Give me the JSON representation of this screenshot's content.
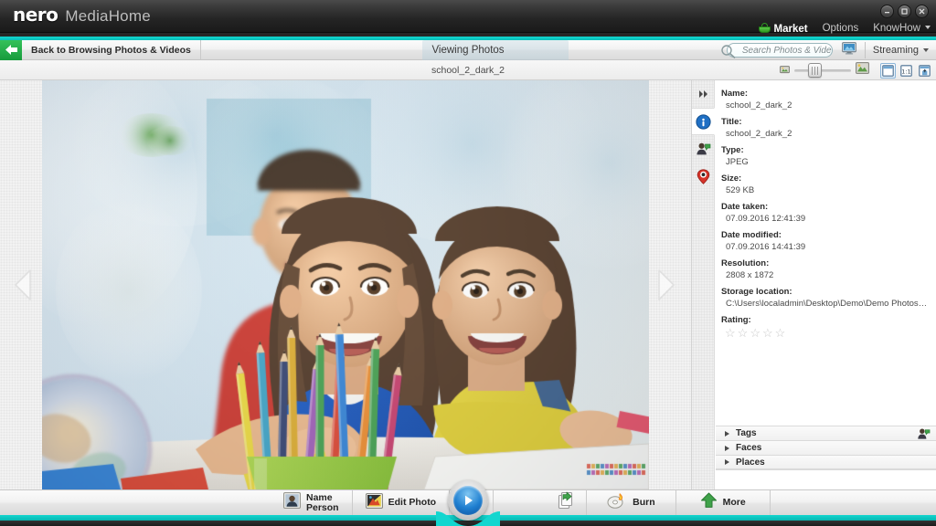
{
  "window": {
    "brand": "nero",
    "app_name": "MediaHome",
    "controls": [
      {
        "name": "minimize",
        "glyph": "–"
      },
      {
        "name": "maximize",
        "glyph": "□"
      },
      {
        "name": "close",
        "glyph": "✕"
      }
    ]
  },
  "topmenu": {
    "market": "Market",
    "options": "Options",
    "knowhow": "KnowHow"
  },
  "navbar": {
    "back_label": "Back to Browsing Photos & Videos",
    "view_label": "Viewing Photos",
    "search_placeholder": "Search Photos & Vide..",
    "streaming_label": "Streaming"
  },
  "toolbar": {
    "file_title": "school_2_dark_2",
    "zoom_value": 25,
    "view_buttons": [
      {
        "name": "fit-to-window",
        "active": true
      },
      {
        "name": "actual-size",
        "label": "1:1",
        "active": false
      },
      {
        "name": "full-screen",
        "active": false
      }
    ]
  },
  "rail": [
    {
      "name": "collapse-panel-icon",
      "active": false
    },
    {
      "name": "info-icon",
      "active": true
    },
    {
      "name": "face-tag-icon",
      "active": false
    },
    {
      "name": "location-pin-icon",
      "active": false
    }
  ],
  "metadata": [
    {
      "label": "Name:",
      "value": "school_2_dark_2"
    },
    {
      "label": "Title:",
      "value": "school_2_dark_2"
    },
    {
      "label": "Type:",
      "value": "JPEG"
    },
    {
      "label": "Size:",
      "value": "529 KB"
    },
    {
      "label": "Date taken:",
      "value": "07.09.2016 12:41:39"
    },
    {
      "label": "Date modified:",
      "value": "07.09.2016 14:41:39"
    },
    {
      "label": "Resolution:",
      "value": "2808 x 1872"
    },
    {
      "label": "Storage location:",
      "value": "C:\\Users\\localadmin\\Desktop\\Demo\\Demo Photos K..."
    }
  ],
  "rating": {
    "label": "Rating:",
    "value": 0,
    "max": 5,
    "star_empty": "☆"
  },
  "sections": [
    {
      "label": "Tags",
      "expanded": false
    },
    {
      "label": "Faces",
      "expanded": false
    },
    {
      "label": "Places",
      "expanded": false
    }
  ],
  "bottombar": {
    "name_person": "Name\nPerson",
    "edit_photo": "Edit Photo",
    "burn": "Burn",
    "more": "More",
    "rotate_left": "rotate-left",
    "rotate_right": "rotate-right",
    "play": "play-slideshow"
  },
  "colors": {
    "accent_teal": "#13d6cf",
    "title_dark": "#242424",
    "green_back": "#1f9e3f",
    "play_blue": "#1f7fd0"
  }
}
